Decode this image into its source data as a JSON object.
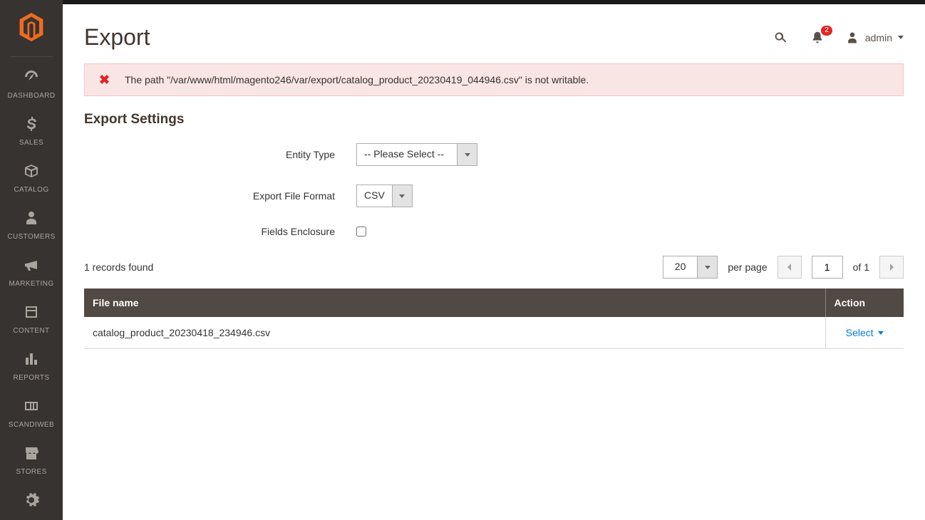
{
  "sidebar": {
    "items": [
      {
        "label": "DASHBOARD"
      },
      {
        "label": "SALES"
      },
      {
        "label": "CATALOG"
      },
      {
        "label": "CUSTOMERS"
      },
      {
        "label": "MARKETING"
      },
      {
        "label": "CONTENT"
      },
      {
        "label": "REPORTS"
      },
      {
        "label": "SCANDIWEB"
      },
      {
        "label": "STORES"
      }
    ]
  },
  "header": {
    "title": "Export",
    "notification_count": "2",
    "user_name": "admin"
  },
  "error": {
    "message": "The path \"/var/www/html/magento246/var/export/catalog_product_20230419_044946.csv\" is not writable."
  },
  "section_title": "Export Settings",
  "form": {
    "entity_type_label": "Entity Type",
    "entity_type_value": "-- Please Select --",
    "file_format_label": "Export File Format",
    "file_format_value": "CSV",
    "fields_enclosure_label": "Fields Enclosure"
  },
  "toolbar": {
    "records_text": "1 records found",
    "page_size": "20",
    "per_page": "per page",
    "page_input": "1",
    "of_text": "of 1"
  },
  "table": {
    "col_file": "File name",
    "col_action": "Action",
    "rows": [
      {
        "filename": "catalog_product_20230418_234946.csv",
        "action": "Select"
      }
    ]
  }
}
